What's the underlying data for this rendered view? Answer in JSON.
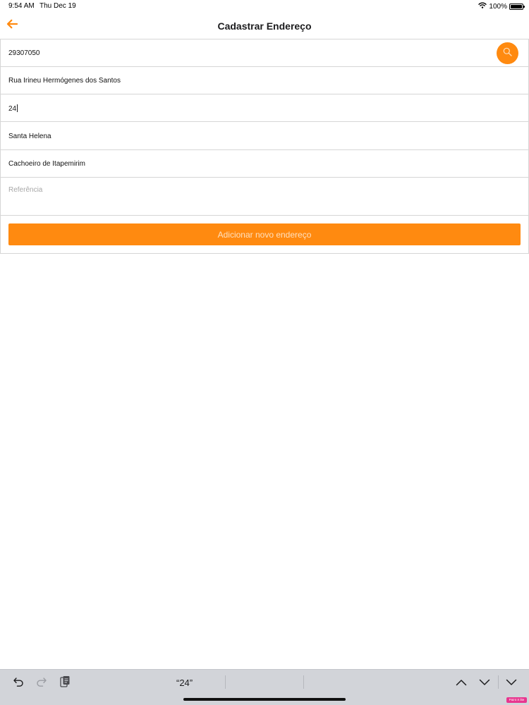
{
  "status_bar": {
    "time": "9:54 AM",
    "date": "Thu Dec 19",
    "battery_text": "100%",
    "wifi_icon": "wifi-icon",
    "battery_icon": "battery-icon"
  },
  "header": {
    "title": "Cadastrar Endereço",
    "back_icon": "arrow-left-icon"
  },
  "form": {
    "fields": [
      {
        "value": "29307050",
        "placeholder": ""
      },
      {
        "value": "Rua Irineu Hermógenes dos Santos",
        "placeholder": ""
      },
      {
        "value": "24",
        "placeholder": ""
      },
      {
        "value": "Santa Helena",
        "placeholder": ""
      },
      {
        "value": "Cachoeiro de Itapemirim",
        "placeholder": ""
      },
      {
        "value": "",
        "placeholder": "Referência"
      }
    ],
    "search_icon": "search-icon",
    "submit_label": "Adicionar novo endereço"
  },
  "keyboard_bar": {
    "suggestion": "“24”",
    "icons": [
      "undo-icon",
      "redo-icon",
      "paste-icon",
      "chevron-up-icon",
      "chevron-down-icon",
      "keyboard-dismiss-icon"
    ]
  },
  "watermark": "Paint X lite",
  "colors": {
    "accent": "#ff8a10",
    "accent_text": "#ffe0bf",
    "divider": "#d6d6d6",
    "placeholder": "#a7a7a7",
    "keyboard_background": "#d2d4d9"
  }
}
